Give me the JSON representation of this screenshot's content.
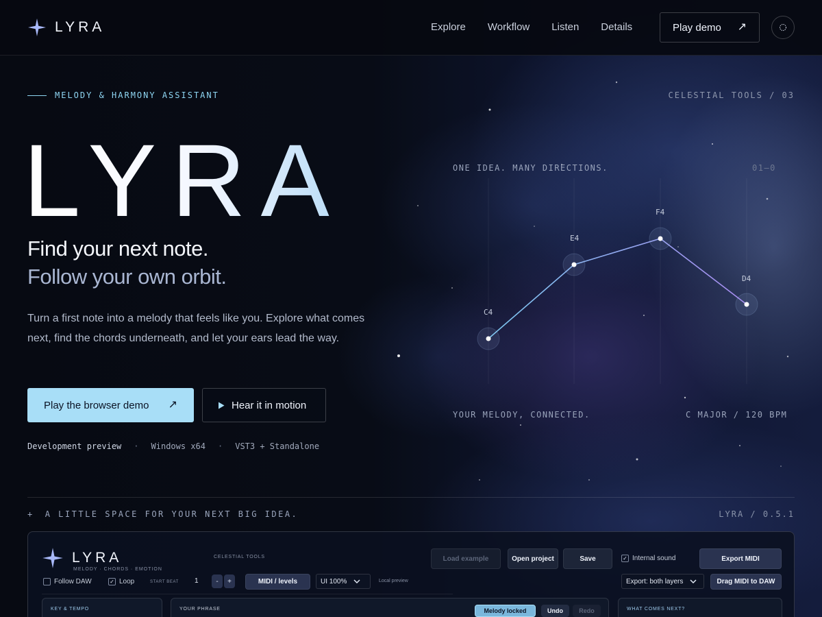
{
  "brand": {
    "name": "LYRA"
  },
  "nav": {
    "items": [
      "Explore",
      "Workflow",
      "Listen",
      "Details"
    ],
    "cta": "Play demo",
    "cta_icon": "arrow-up-right-icon",
    "theme_icon": "circle-icon"
  },
  "hero": {
    "eyebrow": "MELODY & HARMONY ASSISTANT",
    "corner_label": "CELESTIAL TOOLS / 03",
    "title": "LYRA",
    "tagline_1": "Find your next note.",
    "tagline_2": "Follow your own orbit.",
    "description": "Turn a first note into a melody that feels like you. Explore what comes next, find the chords underneath, and let your ears lead the way.",
    "primary_cta": "Play the browser demo",
    "secondary_cta": "Hear it in motion",
    "meta": [
      "Development preview",
      "Windows x64",
      "VST3 + Standalone"
    ]
  },
  "constellation": {
    "top_label": "ONE IDEA. MANY DIRECTIONS.",
    "index_label": "01—0",
    "bottom_left": "YOUR MELODY, CONNECTED.",
    "bottom_right": "C MAJOR / 120 BPM",
    "notes": [
      "C4",
      "E4",
      "F4",
      "D4"
    ]
  },
  "section": {
    "tagline": "A LITTLE SPACE FOR YOUR NEXT BIG IDEA.",
    "version": "LYRA / 0.5.1",
    "plus": "+"
  },
  "app": {
    "brand": "LYRA",
    "subtitle": "MELODY · CHORDS · EMOTION",
    "celestial": "CELESTIAL TOOLS",
    "buttons": {
      "load_example": "Load example",
      "open_project": "Open project",
      "save": "Save",
      "export_midi": "Export MIDI",
      "drag_midi": "Drag MIDI to DAW",
      "midi_levels": "MIDI / levels"
    },
    "internal_sound": "Internal sound",
    "follow_daw": "Follow DAW",
    "loop": "Loop",
    "start_beat_label": "START BEAT",
    "start_beat_value": "1",
    "minus": "-",
    "plus": "+",
    "ui_scale": "UI 100%",
    "local_preview": "Local preview",
    "export_layers": "Export: both layers",
    "panels": {
      "key_tempo": "KEY & TEMPO",
      "your_phrase": "YOUR PHRASE",
      "what_next": "WHAT COMES NEXT?"
    },
    "phrase_buttons": {
      "melody_locked": "Melody locked",
      "undo": "Undo",
      "redo": "Redo"
    }
  },
  "colors": {
    "accent": "#a8def7",
    "line_start": "#7cc8f0",
    "line_end": "#a88bf0"
  }
}
